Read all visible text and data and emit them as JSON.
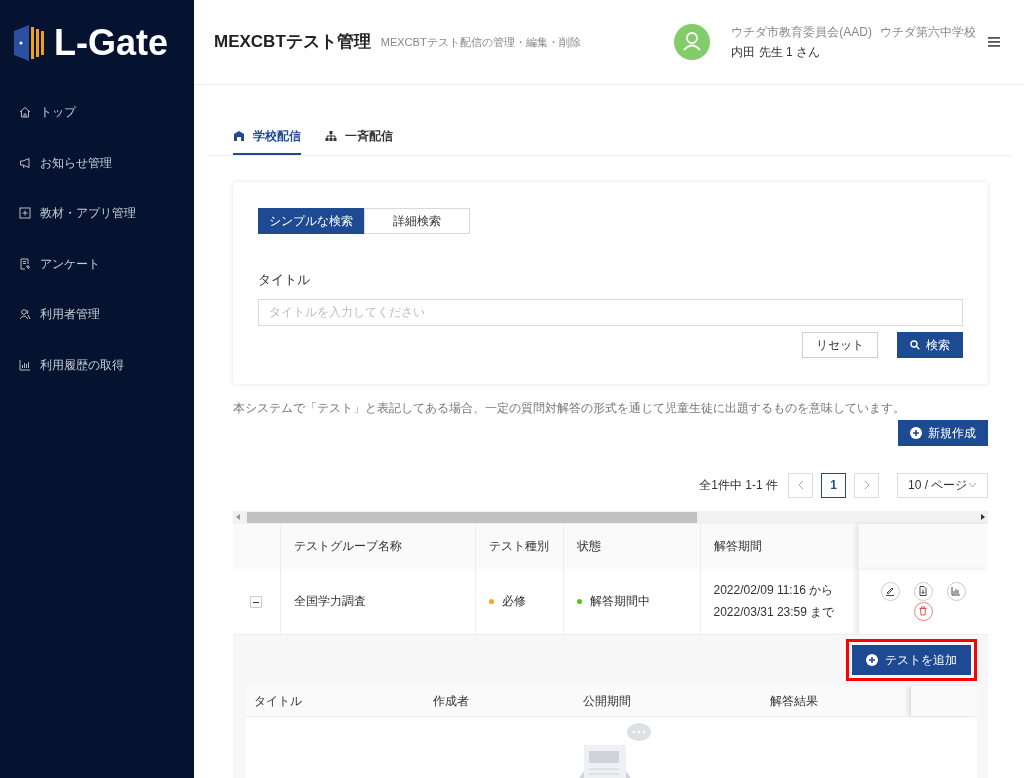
{
  "sidebar": {
    "logo": "L-Gate",
    "items": [
      {
        "label": "トップ"
      },
      {
        "label": "お知らせ管理"
      },
      {
        "label": "教材・アプリ管理"
      },
      {
        "label": "アンケート"
      },
      {
        "label": "利用者管理"
      },
      {
        "label": "利用履歴の取得"
      }
    ]
  },
  "header": {
    "title": "MEXCBTテスト管理",
    "subtitle": "MEXCBTテスト配信の管理・編集・削除",
    "organization": "ウチダ市教育委員会(AAD)",
    "school": "ウチダ第六中学校",
    "user": "内田 先生 1 さん"
  },
  "tabs": [
    {
      "label": "学校配信",
      "selected": true
    },
    {
      "label": "一斉配信",
      "selected": false
    }
  ],
  "search": {
    "modes": [
      {
        "label": "シンプルな検索",
        "selected": true
      },
      {
        "label": "詳細検索",
        "selected": false
      }
    ],
    "field_label": "タイトル",
    "placeholder": "タイトルを入力してください",
    "reset_button": "リセット",
    "search_button": "検索"
  },
  "notice": "本システムで「テスト」と表記してある場合、一定の質問対解答の形式を通じて児童生徒に出題するものを意味しています。",
  "new_button": "新規作成",
  "pagination": {
    "summary": "全1件中 1-1 件",
    "pages": [
      {
        "label": "1",
        "selected": true
      }
    ],
    "page_size": "10 / ページ"
  },
  "table": {
    "columns": [
      "テストグループ名称",
      "テスト種別",
      "状態",
      "解答期間"
    ],
    "rows": [
      {
        "expanded": true,
        "name": "全国学力調査",
        "type": {
          "label": "必修",
          "color": "#f5a623"
        },
        "status": {
          "label": "解答期間中",
          "color": "#52c41a"
        },
        "period": [
          "2022/02/09 11:16 から",
          "2022/03/31 23:59 まで"
        ]
      }
    ]
  },
  "detail": {
    "add_button": "テストを追加",
    "highlighted": true,
    "columns": [
      "タイトル",
      "作成者",
      "公開期間",
      "解答結果"
    ]
  }
}
